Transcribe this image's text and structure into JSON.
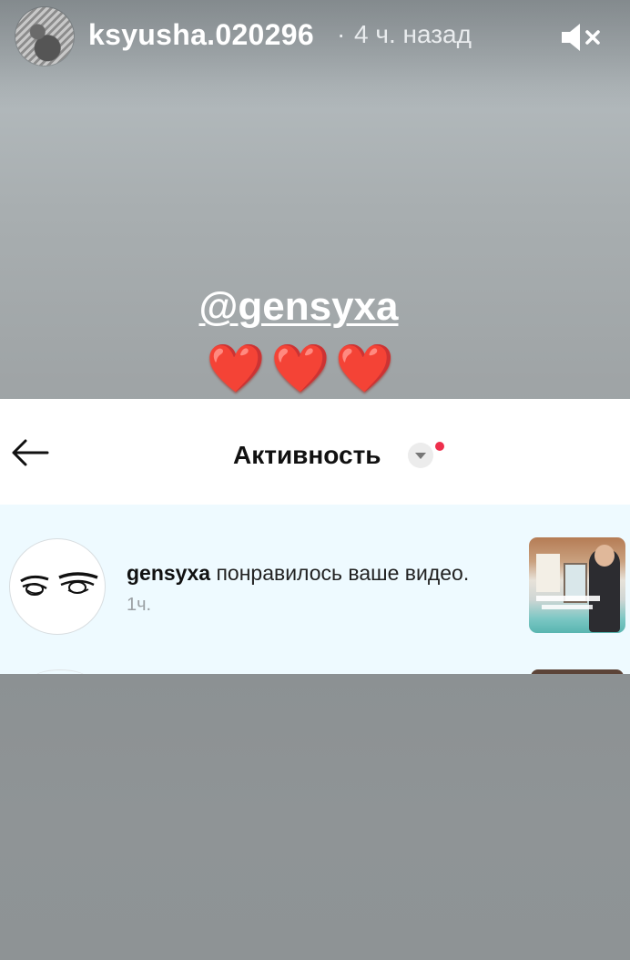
{
  "story": {
    "username": "ksyusha.020296",
    "separator": "·",
    "time_ago": "4 ч. назад",
    "mention": "@gensyxa",
    "hearts": "❤️❤️❤️"
  },
  "screenshot": {
    "title": "Активность",
    "notification": {
      "user": "gensyxa",
      "action": " понравилось ваше видео.",
      "time": "1ч."
    }
  },
  "icons": {
    "mute": "speaker-muted-icon",
    "back": "arrow-left-icon",
    "dropdown": "chevron-down-icon"
  },
  "colors": {
    "notification_bg": "#eefaff",
    "red_dot": "#ee2f4c",
    "heart": "#e8453c"
  }
}
